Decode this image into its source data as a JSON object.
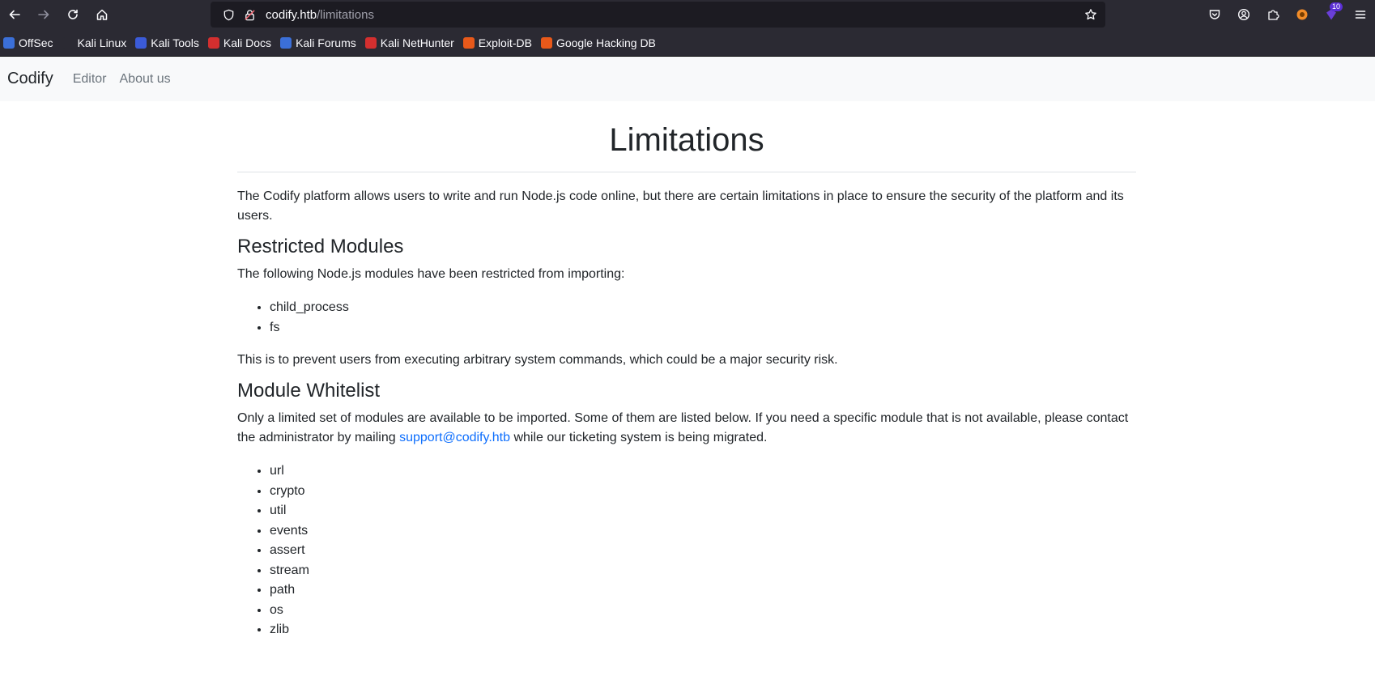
{
  "browser": {
    "url_host": "codify.htb",
    "url_path": "/limitations",
    "extensions_badge": "10",
    "bookmarks": [
      {
        "label": "OffSec",
        "color": "#3b6fd8"
      },
      {
        "label": "Kali Linux",
        "color": "#2b2a33"
      },
      {
        "label": "Kali Tools",
        "color": "#3b5bd8"
      },
      {
        "label": "Kali Docs",
        "color": "#d32f2f"
      },
      {
        "label": "Kali Forums",
        "color": "#3b6fd8"
      },
      {
        "label": "Kali NetHunter",
        "color": "#d32f2f"
      },
      {
        "label": "Exploit-DB",
        "color": "#e8591a"
      },
      {
        "label": "Google Hacking DB",
        "color": "#e8591a"
      }
    ]
  },
  "navbar": {
    "brand": "Codify",
    "links": [
      "Editor",
      "About us"
    ]
  },
  "page": {
    "title": "Limitations",
    "intro": "The Codify platform allows users to write and run Node.js code online, but there are certain limitations in place to ensure the security of the platform and its users.",
    "restricted": {
      "heading": "Restricted Modules",
      "text": "The following Node.js modules have been restricted from importing:",
      "modules": [
        "child_process",
        "fs"
      ],
      "note": "This is to prevent users from executing arbitrary system commands, which could be a major security risk."
    },
    "whitelist": {
      "heading": "Module Whitelist",
      "text_before": "Only a limited set of modules are available to be imported. Some of them are listed below. If you need a specific module that is not available, please contact the administrator by mailing ",
      "email": "support@codify.htb",
      "text_after": " while our ticketing system is being migrated.",
      "modules": [
        "url",
        "crypto",
        "util",
        "events",
        "assert",
        "stream",
        "path",
        "os",
        "zlib"
      ]
    }
  }
}
